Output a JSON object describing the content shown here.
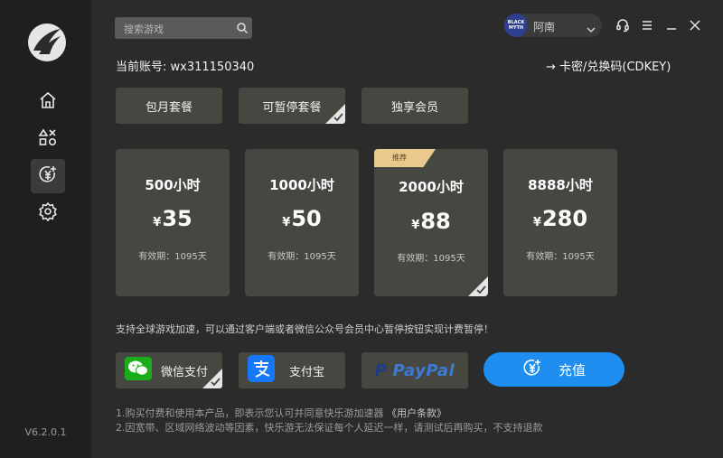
{
  "sidebar": {
    "version": "V6.2.0.1",
    "nav": [
      {
        "icon": "home-icon"
      },
      {
        "icon": "apps-icon"
      },
      {
        "icon": "recharge-icon",
        "active": true
      },
      {
        "icon": "settings-icon"
      }
    ]
  },
  "header": {
    "search_placeholder": "搜索游戏",
    "avatar_text": "BLACK MYTH",
    "username": "阿南"
  },
  "account": {
    "label": "当前账号: wx311150340",
    "cdkey_link": "→ 卡密/兑换码(CDKEY)"
  },
  "tabs": [
    {
      "label": "包月套餐"
    },
    {
      "label": "可暂停套餐",
      "selected": true
    },
    {
      "label": "独享会员"
    }
  ],
  "currency": "¥",
  "plans": [
    {
      "hours": "500小时",
      "price": "35",
      "validity": "有效期：1095天"
    },
    {
      "hours": "1000小时",
      "price": "50",
      "validity": "有效期：1095天"
    },
    {
      "hours": "2000小时",
      "price": "88",
      "validity": "有效期：1095天",
      "badge": "推荐",
      "selected": true
    },
    {
      "hours": "8888小时",
      "price": "280",
      "validity": "有效期：1095天"
    }
  ],
  "notice": "支持全球游戏加速，可以通过客户端或者微信公众号会员中心暂停按钮实现计费暂停！",
  "payments": {
    "wechat": "微信支付",
    "alipay": "支付宝",
    "paypal": "PayPal"
  },
  "recharge_label": "充值",
  "terms": {
    "line1_prefix": "1.购买付费和使用本产品，即表示您认可并同意快乐游加速器",
    "line1_link": "《用户条款》",
    "line2": "2.因宽带、区域网络波动等因素，快乐游无法保证每个人延迟一样，请测试后再购买，不支持退款"
  },
  "colors": {
    "accent_blue": "#1e8ff0",
    "badge_gold": "#e9c98e",
    "card_bg": "#474741",
    "wechat_green": "#1aad19",
    "alipay_blue": "#1677ff"
  }
}
